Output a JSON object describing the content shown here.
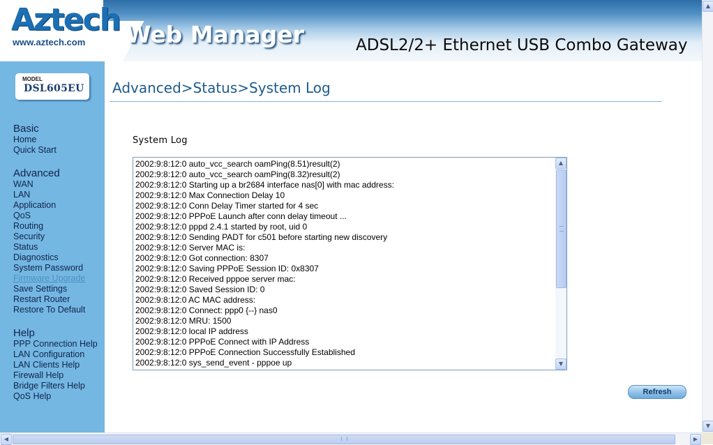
{
  "header": {
    "brand": "Aztech",
    "brand_url": "www.aztech.com",
    "title": "Web Manager",
    "product": "ADSL2/2+ Ethernet USB Combo Gateway"
  },
  "sidebar": {
    "model_label": "MODEL",
    "model_value": "DSL605EU",
    "sections": [
      {
        "heading": "Basic",
        "items": [
          "Home",
          "Quick Start"
        ]
      },
      {
        "heading": "Advanced",
        "items": [
          "WAN",
          "LAN",
          "Application",
          "QoS",
          "Routing",
          "Security",
          "Status",
          "Diagnostics",
          "System Password",
          "Firmware Upgrade",
          "Save Settings",
          "Restart Router",
          "Restore To Default"
        ]
      },
      {
        "heading": "Help",
        "items": [
          "PPP Connection Help",
          "LAN Configuration",
          "LAN Clients Help",
          "Firewall Help",
          "Bridge Filters Help",
          "QoS Help"
        ]
      }
    ]
  },
  "main": {
    "page_title": "Advanced>Status>System Log",
    "section_label": "System Log",
    "refresh_label": "Refresh",
    "log_lines": [
      "2002:9:8:12:0 auto_vcc_search oamPing(8.51)result(2)",
      "2002:9:8:12:0 auto_vcc_search oamPing(8.32)result(2)",
      "2002:9:8:12:0 Starting up a br2684 interface nas[0] with mac address: ",
      "2002:9:8:12:0 Max Connection Delay 10",
      "2002:9:8:12:0 Conn Delay Timer started for 4 sec",
      "2002:9:8:12:0 PPPoE Launch after conn delay timeout ...",
      "2002:9:8:12:0 pppd 2.4.1 started by root, uid 0",
      "2002:9:8:12:0 Sending PADT for c501 before starting new discovery",
      "2002:9:8:12:0 Server MAC is:",
      "2002:9:8:12:0 Got connection: 8307",
      "2002:9:8:12:0 Saving PPPoE Session ID: 0x8307",
      "2002:9:8:12:0 Received pppoe server mac:",
      "2002:9:8:12:0 Saved Session ID: 0",
      "2002:9:8:12:0 AC MAC address:",
      "2002:9:8:12:0 Connect: ppp0 {--} nas0",
      "2002:9:8:12:0 MRU: 1500",
      "2002:9:8:12:0 local  IP address",
      "2002:9:8:12:0 PPPoE Connect with IP Address",
      "2002:9:8:12:0 PPPoE Connection Successfully Established",
      "2002:9:8:12:0 sys_send_event - pppoe up"
    ]
  },
  "colors": {
    "sidebar_bg": "#74b7e3",
    "title_color": "#1d5b8c",
    "brand_color": "#1b6fb2"
  },
  "icons": {
    "scroll_up": "arrow-up-icon",
    "scroll_down": "arrow-down-icon",
    "scroll_left": "arrow-left-icon",
    "scroll_right": "arrow-right-icon"
  }
}
